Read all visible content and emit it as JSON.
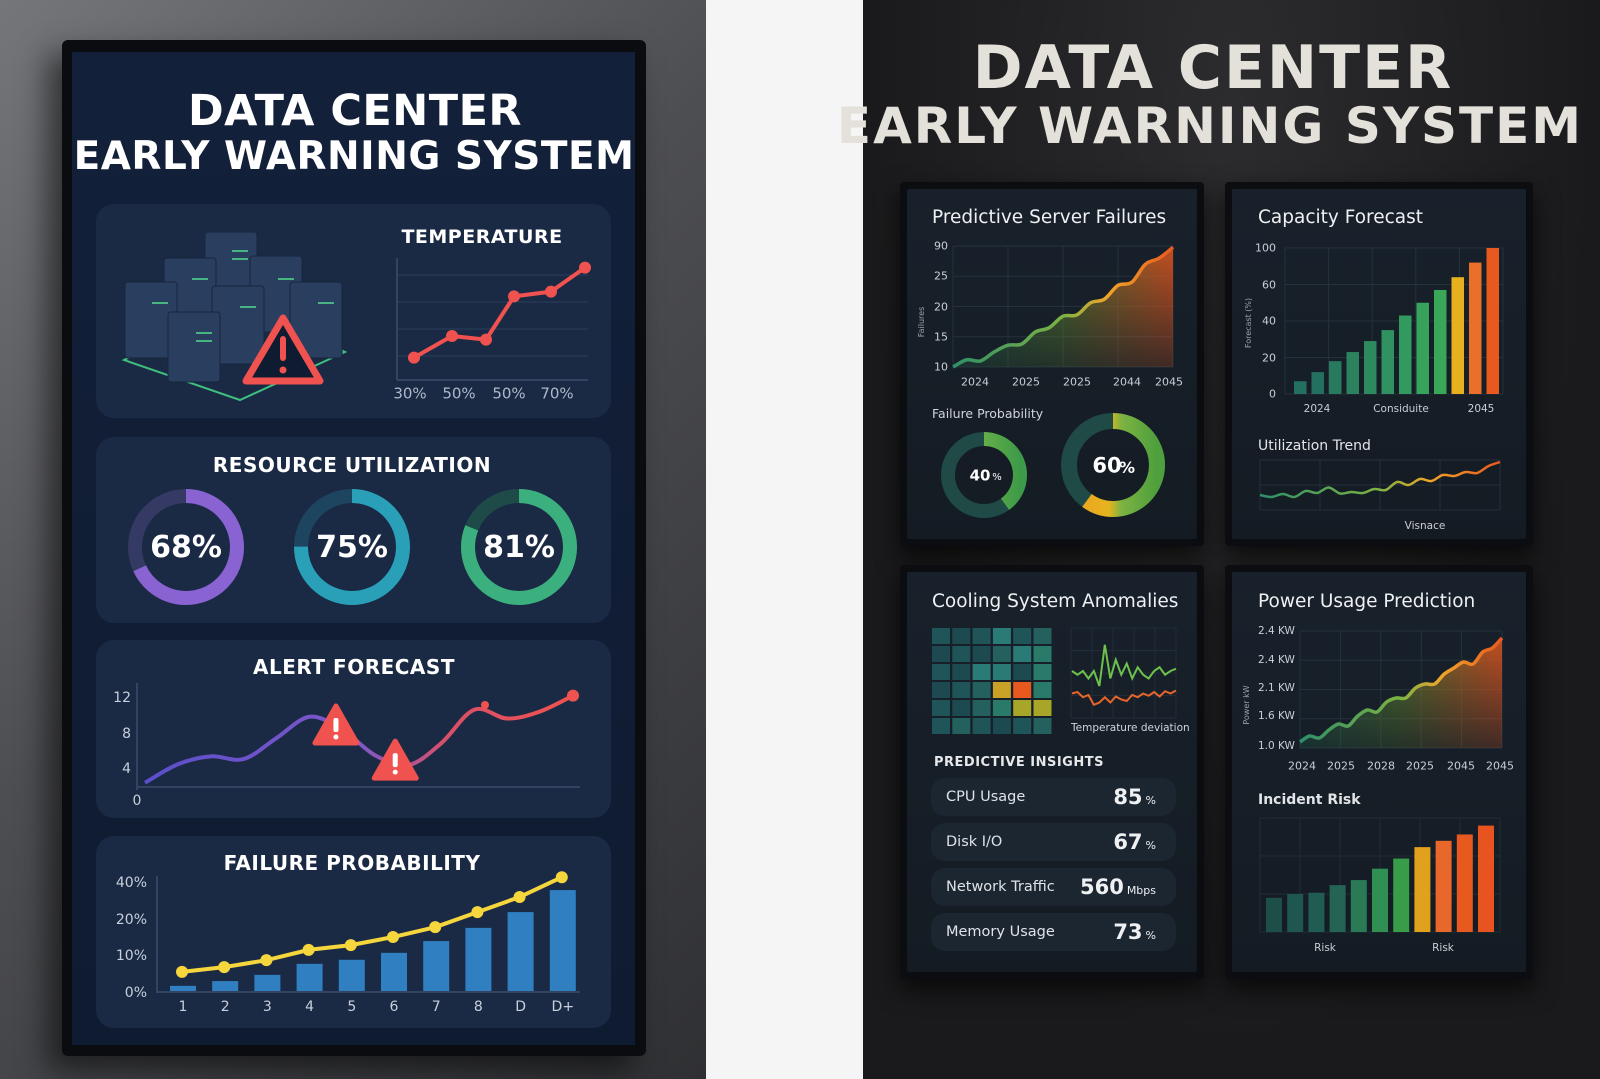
{
  "left_screen": {
    "title_line1": "DATA CENTER",
    "title_line2": "EARLY WARNING SYSTEM",
    "temperature": {
      "title": "TEMPERATURE"
    },
    "resource_utilization": {
      "title": "RESOURCE UTILIZATION"
    },
    "alert_forecast": {
      "title": "ALERT FORECAST"
    },
    "failure_probability": {
      "title": "FAILURE PROBABILITY"
    }
  },
  "right_board": {
    "title_line1": "DATA CENTER",
    "title_line2": "EARLY WARNING SYSTEM",
    "predictive_server_failures": {
      "title": "Predictive Server Failures",
      "subtitle": "Failure Probability"
    },
    "capacity_forecast": {
      "title": "Capacity Forecast",
      "subtitle": "Utilization Trend"
    },
    "cooling": {
      "title": "Cooling System Anomalies",
      "deviation_label": "Temperature deviation"
    },
    "insights": {
      "title": "PREDICTIVE INSIGHTS",
      "rows": [
        {
          "label": "CPU Usage",
          "value": "85",
          "unit": "%"
        },
        {
          "label": "Disk I/O",
          "value": "67",
          "unit": "%"
        },
        {
          "label": "Network Traffic",
          "value": "560",
          "unit": "Mbps"
        },
        {
          "label": "Memory Usage",
          "value": "73",
          "unit": "%"
        }
      ]
    },
    "power": {
      "title": "Power Usage Prediction",
      "subtitle": "Incident Risk"
    }
  },
  "colors": {
    "accent_red": "#f0524f",
    "yellow": "#f5d63d",
    "bar_blue": "#2f7fc1",
    "green": "#3aa86b",
    "orange": "#e8591f"
  },
  "chart_data": [
    {
      "id": "temperature",
      "type": "line",
      "title": "TEMPERATURE",
      "tick_labels": [
        "30%",
        "50%",
        "50%",
        "70%"
      ],
      "values": [
        17,
        35,
        32,
        68,
        72,
        92
      ],
      "ylim": [
        0,
        100
      ],
      "color": "#f0524f"
    },
    {
      "id": "resource_utilization",
      "type": "pie",
      "title": "RESOURCE UTILIZATION",
      "values": [
        68,
        75,
        81
      ],
      "labels": [
        "68%",
        "75%",
        "81%"
      ],
      "colors": [
        "#8a63d2",
        "#2a9fb8",
        "#3bb07e"
      ],
      "tracks": [
        "#343a63",
        "#1d4560",
        "#1e4a48"
      ]
    },
    {
      "id": "alert_forecast",
      "type": "line",
      "title": "ALERT FORECAST",
      "yticks": [
        "0",
        "4",
        "8",
        "12"
      ],
      "ytick_values": [
        0,
        4,
        8,
        12
      ],
      "values": [
        2.3,
        4.4,
        5.3,
        5.0,
        7.4,
        9.8,
        8.3,
        5.4,
        4.3,
        6.8,
        10.6,
        9.6,
        10.4,
        12.2
      ],
      "warnings_at": [
        5.8,
        7.6
      ],
      "ylim": [
        0,
        12
      ]
    },
    {
      "id": "failure_probability",
      "type": "bar",
      "title": "FAILURE PROBABILITY",
      "categories": [
        "1",
        "2",
        "3",
        "4",
        "5",
        "6",
        "7",
        "8",
        "D",
        "D+"
      ],
      "yticks": [
        "0%",
        "10%",
        "20%",
        "40%"
      ],
      "bars": [
        0.14,
        0.27,
        0.44,
        0.74,
        0.85,
        1.04,
        1.36,
        1.72,
        2.15,
        2.75
      ],
      "line": [
        0.52,
        0.65,
        0.84,
        1.12,
        1.25,
        1.47,
        1.74,
        2.15,
        2.56,
        3.1
      ],
      "ylim": [
        0,
        3
      ]
    },
    {
      "id": "predictive_server_failures",
      "type": "area",
      "title": "Predictive Server Failures",
      "ylabel": "Failures",
      "yticks": [
        "10",
        "15",
        "20",
        "25",
        "90"
      ],
      "ytick_values": [
        10,
        15,
        20,
        25,
        30
      ],
      "xticks": [
        "2024",
        "2025",
        "2025",
        "2044",
        "2045"
      ],
      "values": [
        10,
        11.2,
        11.0,
        12.5,
        13.6,
        13.8,
        15.8,
        16.5,
        18.4,
        18.6,
        20.6,
        21.2,
        23.5,
        24.0,
        27.0,
        28.0,
        29.8
      ],
      "ylim": [
        10,
        30
      ]
    },
    {
      "id": "failure_probability_donuts",
      "type": "pie",
      "title": "Failure Probability",
      "values": [
        40,
        60
      ],
      "labels": [
        "40",
        "60"
      ],
      "unit": "%"
    },
    {
      "id": "capacity_forecast",
      "type": "bar",
      "title": "Capacity Forecast",
      "ylabel": "Forecast (%)",
      "yticks": [
        "0",
        "20",
        "40",
        "60",
        "100"
      ],
      "ytick_values": [
        0,
        20,
        40,
        60,
        80
      ],
      "xticks": [
        "2024",
        "Considuite",
        "2045"
      ],
      "values": [
        7,
        12,
        18,
        23,
        29,
        35,
        43,
        50,
        57,
        64,
        72,
        80
      ],
      "colors": [
        "#23705e",
        "#23705e",
        "#277a5e",
        "#2a825f",
        "#2d8a5f",
        "#309260",
        "#339a5f",
        "#37a25c",
        "#3aa658",
        "#e6b01e",
        "#e8702a",
        "#e8591f"
      ],
      "ylim": [
        0,
        80
      ]
    },
    {
      "id": "utilization_trend",
      "type": "line",
      "title": "Utilization Trend",
      "xlabel": "Visnace",
      "values": [
        3,
        2.6,
        3.2,
        2.6,
        3.8,
        3.4,
        4.5,
        3.3,
        3.6,
        3.4,
        4.2,
        4.0,
        5.6,
        5.0,
        6.2,
        5.8,
        7.0,
        6.8,
        7.6,
        7.4,
        8.8,
        9.6
      ],
      "ylim": [
        0,
        10
      ]
    },
    {
      "id": "cooling_heatmap",
      "type": "heatmap",
      "title": "Cooling System Anomalies",
      "cells": [
        [
          "#1f5558",
          "#1d4a50",
          "#1f5558",
          "#2a7a78",
          "#1f5558",
          "#23605e"
        ],
        [
          "#1d4a50",
          "#1f5558",
          "#1d4a50",
          "#23605e",
          "#2a7a78",
          "#2a7a6a"
        ],
        [
          "#1f5558",
          "#1d4a50",
          "#2a7a78",
          "#2a7a78",
          "#1d4a50",
          "#2a7a6a"
        ],
        [
          "#1d4a50",
          "#1f5558",
          "#23605e",
          "#c9a227",
          "#e8591f",
          "#2a7a6a"
        ],
        [
          "#1f5558",
          "#1d4a50",
          "#23605e",
          "#2a7a6a",
          "#a8a628",
          "#a8a628"
        ],
        [
          "#1f5558",
          "#23605e",
          "#1f5558",
          "#1d4a50",
          "#1f5558",
          "#23605e"
        ]
      ]
    },
    {
      "id": "temperature_deviation",
      "type": "line",
      "title": "Temperature deviation",
      "series": [
        {
          "name": "green",
          "color": "#6cc24a",
          "values": [
            6,
            5.5,
            6,
            5,
            6,
            4,
            9.5,
            5,
            7.5,
            5.5,
            7,
            5,
            6.5,
            5.5,
            5,
            6,
            6.5,
            5.5,
            6,
            6.3
          ]
        },
        {
          "name": "orange",
          "color": "#e8652a",
          "values": [
            3,
            3.2,
            2.5,
            2.8,
            1.5,
            1.8,
            2.5,
            1.8,
            2.6,
            2.2,
            2.0,
            2.8,
            2.5,
            3.0,
            2.7,
            3.2,
            2.6,
            3.3,
            3.0,
            3.4
          ]
        }
      ],
      "ylim": [
        0,
        12
      ]
    },
    {
      "id": "power_usage",
      "type": "area",
      "title": "Power Usage Prediction",
      "ylabel": "Power kW",
      "yticks": [
        "1.0 KW",
        "1.6 KW",
        "2.1 KW",
        "2.4 KW",
        "2.4 KW"
      ],
      "xticks": [
        "2024",
        "2025",
        "2028",
        "2025",
        "2045",
        "2045"
      ],
      "values": [
        0.3,
        0.6,
        0.5,
        0.9,
        1.2,
        1.1,
        1.6,
        1.9,
        1.8,
        2.3,
        2.5,
        2.5,
        3.0,
        3.2,
        3.2,
        3.7,
        4.0,
        4.3,
        4.2,
        4.8,
        5.0,
        5.5
      ],
      "ylim": [
        0,
        6
      ]
    },
    {
      "id": "incident_risk",
      "type": "bar",
      "title": "Incident Risk",
      "xticks": [
        "Risk",
        "Risk"
      ],
      "values": [
        27,
        30,
        31,
        37,
        41,
        50,
        58,
        67,
        72,
        77,
        84
      ],
      "colors": [
        "#1d4e48",
        "#1f5650",
        "#215c52",
        "#236454",
        "#2a7a55",
        "#308f52",
        "#389c48",
        "#e0a21c",
        "#e8672a",
        "#e8591f",
        "#e85420"
      ],
      "ylim": [
        0,
        90
      ]
    }
  ]
}
